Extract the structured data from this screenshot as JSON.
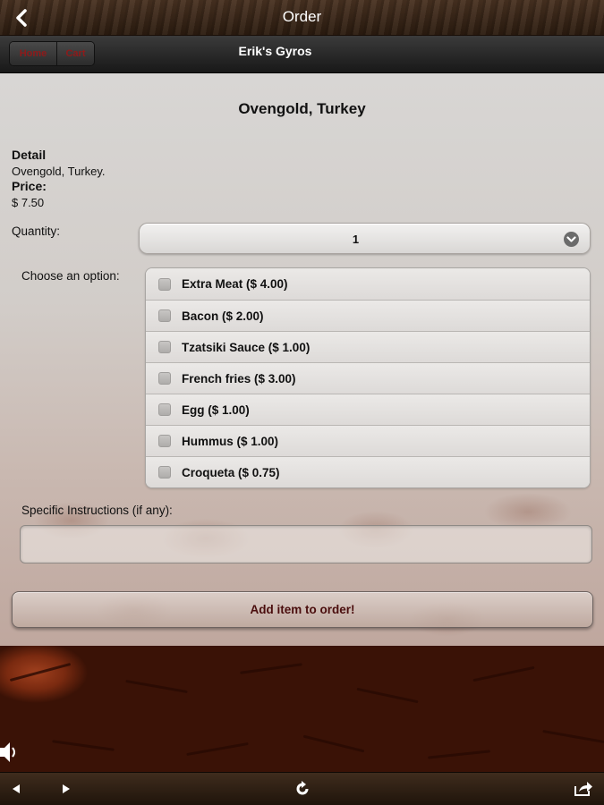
{
  "topbar": {
    "title": "Order"
  },
  "navbar": {
    "home_label": "Home",
    "cart_label": "Cart",
    "title": "Erik's Gyros"
  },
  "item": {
    "title": "Ovengold, Turkey",
    "detail_label": "Detail",
    "detail_text": "Ovengold, Turkey.",
    "price_label": "Price:",
    "price_value": "$ 7.50"
  },
  "quantity": {
    "label": "Quantity:",
    "value": "1"
  },
  "options": {
    "label": "Choose an option:",
    "items": [
      {
        "label": "Extra Meat ($ 4.00)",
        "checked": false
      },
      {
        "label": "Bacon ($ 2.00)",
        "checked": false
      },
      {
        "label": "Tzatsiki Sauce ($ 1.00)",
        "checked": false
      },
      {
        "label": "French fries ($ 3.00)",
        "checked": false
      },
      {
        "label": "Egg ($ 1.00)",
        "checked": false
      },
      {
        "label": "Hummus ($ 1.00)",
        "checked": false
      },
      {
        "label": "Croqueta ($ 0.75)",
        "checked": false
      }
    ]
  },
  "instructions": {
    "label": "Specific Instructions (if any):",
    "value": ""
  },
  "add_button": {
    "label": "Add item to order!"
  },
  "toolbar": {
    "icons": [
      "speaker-icon",
      "back-arrow-icon",
      "forward-arrow-icon",
      "refresh-icon",
      "share-icon"
    ]
  },
  "colors": {
    "button_text": "#4a0d0d",
    "nav_text": "#8e1a1a"
  }
}
